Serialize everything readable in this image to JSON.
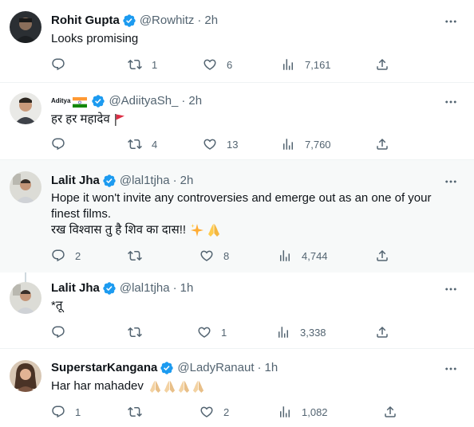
{
  "tweets": [
    {
      "name": "Rohit Gupta",
      "handle": "@Rowhitz",
      "dot": "·",
      "time": "2h",
      "text": "Looks promising",
      "replies": "",
      "retweets": "1",
      "likes": "6",
      "views": "7,161"
    },
    {
      "name": "Aditya",
      "handle": "@AdiityaSh_",
      "dot": "·",
      "time": "2h",
      "text": "हर हर महादेव",
      "replies": "",
      "retweets": "4",
      "likes": "13",
      "views": "7,760"
    },
    {
      "name": "Lalit Jha",
      "handle": "@lal1tjha",
      "dot": "·",
      "time": "2h",
      "text_line1": "Hope it won't invite any controversies and emerge out as an one of your",
      "text_line2": "finest films.",
      "text_line3": "रख विश्वास तु है शिव का दास!!",
      "replies": "2",
      "retweets": "",
      "likes": "8",
      "views": "4,744"
    },
    {
      "name": "Lalit Jha",
      "handle": "@lal1tjha",
      "dot": "·",
      "time": "1h",
      "text": "*तू",
      "replies": "",
      "retweets": "",
      "likes": "1",
      "views": "3,338"
    },
    {
      "name": "SuperstarKangana",
      "handle": "@LadyRanaut",
      "dot": "·",
      "time": "1h",
      "text": "Har har mahadev",
      "replies": "1",
      "retweets": "",
      "likes": "2",
      "views": "1,082"
    }
  ],
  "icons": {
    "reply": "reply-icon",
    "retweet": "retweet-icon",
    "like": "heart-icon",
    "views": "views-icon",
    "share": "share-icon",
    "more": "more-icon",
    "verified": "verified-badge-icon"
  },
  "colors": {
    "verified": "#1d9bf0",
    "muted": "#536471",
    "text": "#0f1419",
    "divider": "#eff3f4",
    "highlight_bg": "#f7f9f9"
  }
}
